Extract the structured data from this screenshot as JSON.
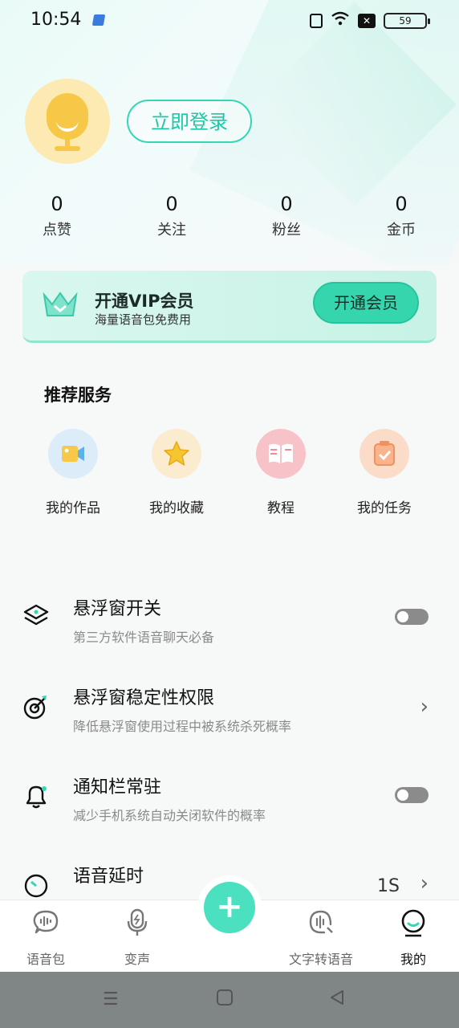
{
  "status_bar": {
    "time": "10:54",
    "battery": "59"
  },
  "profile": {
    "login_label": "立即登录"
  },
  "stats": [
    {
      "value": "0",
      "label": "点赞"
    },
    {
      "value": "0",
      "label": "关注"
    },
    {
      "value": "0",
      "label": "粉丝"
    },
    {
      "value": "0",
      "label": "金币"
    }
  ],
  "vip": {
    "title": "开通VIP会员",
    "subtitle": "海量语音包免费用",
    "button": "开通会员"
  },
  "recommended": {
    "title": "推荐服务",
    "items": [
      {
        "label": "我的作品",
        "icon": "video-icon",
        "color": "#dcecf9"
      },
      {
        "label": "我的收藏",
        "icon": "star-icon",
        "color": "#fbecd0"
      },
      {
        "label": "教程",
        "icon": "book-icon",
        "color": "#f7c2c8"
      },
      {
        "label": "我的任务",
        "icon": "clipboard-icon",
        "color": "#fbdcc9"
      }
    ]
  },
  "settings": [
    {
      "title": "悬浮窗开关",
      "subtitle": "第三方软件语音聊天必备",
      "control": "toggle",
      "state": "off",
      "icon": "layers-icon"
    },
    {
      "title": "悬浮窗稳定性权限",
      "subtitle": "降低悬浮窗使用过程中被系统杀死概率",
      "control": "chevron",
      "icon": "target-icon"
    },
    {
      "title": "通知栏常驻",
      "subtitle": "减少手机系统自动关闭软件的概率",
      "control": "toggle",
      "state": "off",
      "icon": "bell-icon"
    },
    {
      "title": "语音延时",
      "value": "1S",
      "control": "chevron",
      "icon": "timer-icon"
    }
  ],
  "bottom_nav": [
    {
      "label": "语音包",
      "icon": "voice-pack-icon",
      "active": false
    },
    {
      "label": "变声",
      "icon": "microphone-icon",
      "active": false
    },
    {
      "label": "文字转语音",
      "icon": "text-to-speech-icon",
      "active": false
    },
    {
      "label": "我的",
      "icon": "profile-icon",
      "active": true
    }
  ],
  "accent_color": "#35d6ae"
}
